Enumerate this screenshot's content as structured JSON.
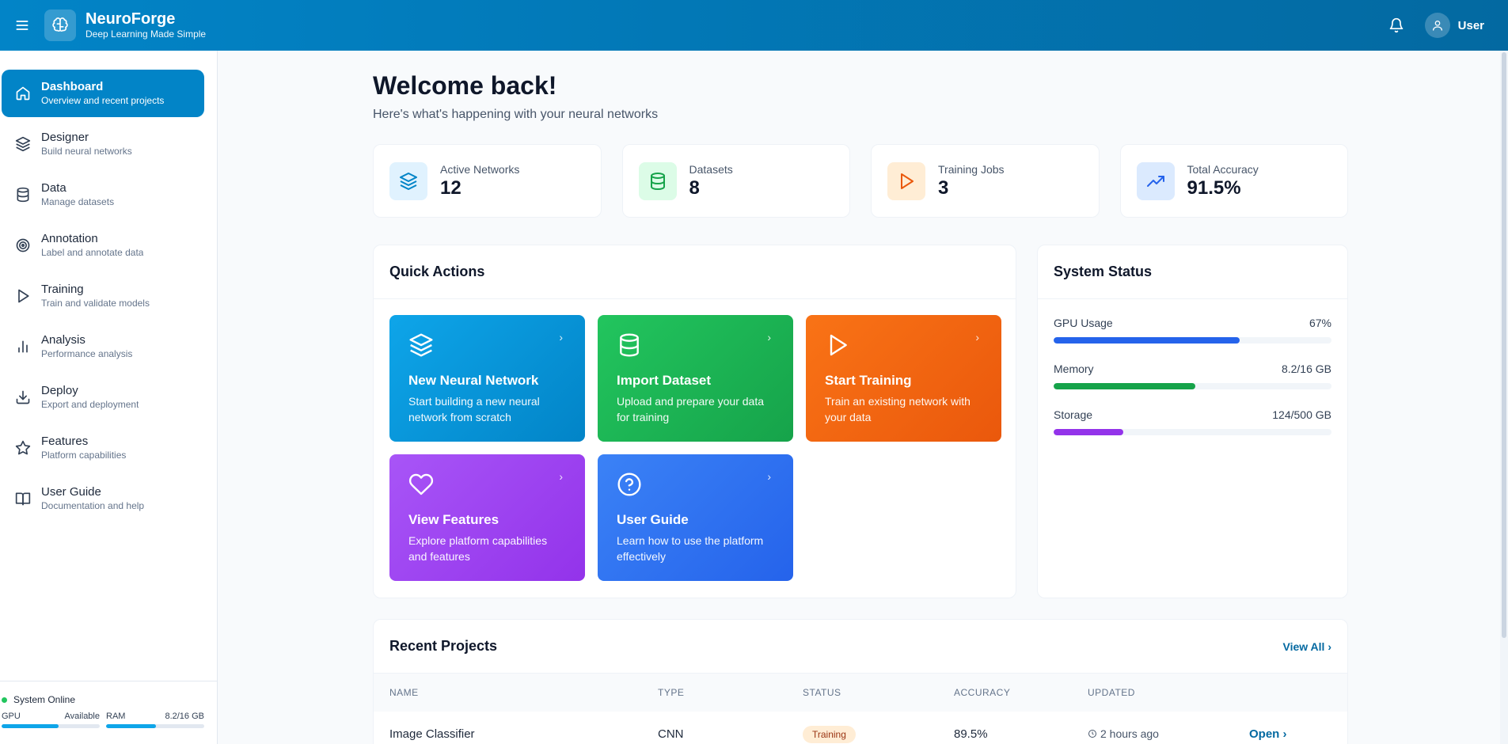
{
  "header": {
    "brand_title": "NeuroForge",
    "brand_subtitle": "Deep Learning Made Simple",
    "user_label": "User"
  },
  "sidebar": {
    "items": [
      {
        "label": "Dashboard",
        "desc": "Overview and recent projects",
        "icon": "home-icon"
      },
      {
        "label": "Designer",
        "desc": "Build neural networks",
        "icon": "layers-icon"
      },
      {
        "label": "Data",
        "desc": "Manage datasets",
        "icon": "database-icon"
      },
      {
        "label": "Annotation",
        "desc": "Label and annotate data",
        "icon": "target-icon"
      },
      {
        "label": "Training",
        "desc": "Train and validate models",
        "icon": "play-icon"
      },
      {
        "label": "Analysis",
        "desc": "Performance analysis",
        "icon": "bar-chart-icon"
      },
      {
        "label": "Deploy",
        "desc": "Export and deployment",
        "icon": "download-icon"
      },
      {
        "label": "Features",
        "desc": "Platform capabilities",
        "icon": "star-icon"
      },
      {
        "label": "User Guide",
        "desc": "Documentation and help",
        "icon": "book-icon"
      }
    ],
    "footer": {
      "status": "System Online",
      "gpu_label": "GPU",
      "gpu_value": "Available",
      "gpu_level": 0.58,
      "ram_label": "RAM",
      "ram_value": "8.2/16 GB",
      "ram_level": 0.51
    }
  },
  "main": {
    "welcome": "Welcome back!",
    "subtitle": "Here's what's happening with your neural networks",
    "stats": [
      {
        "label": "Active Networks",
        "value": "12",
        "icon": "layers-icon",
        "color": "#0284c7",
        "bg": "#e0f2fe"
      },
      {
        "label": "Datasets",
        "value": "8",
        "icon": "database-icon",
        "color": "#16a34a",
        "bg": "#dcfce7"
      },
      {
        "label": "Training Jobs",
        "value": "3",
        "icon": "play-icon",
        "color": "#ea580c",
        "bg": "#ffedd5"
      },
      {
        "label": "Total Accuracy",
        "value": "91.5%",
        "icon": "trending-up-icon",
        "color": "#2563eb",
        "bg": "#dbeafe"
      }
    ],
    "quick_actions": {
      "title": "Quick Actions",
      "items": [
        {
          "title": "New Neural Network",
          "desc": "Start building a new neural network from scratch",
          "icon": "layers-icon"
        },
        {
          "title": "Import Dataset",
          "desc": "Upload and prepare your data for training",
          "icon": "database-icon"
        },
        {
          "title": "Start Training",
          "desc": "Train an existing network with your data",
          "icon": "play-icon"
        },
        {
          "title": "View Features",
          "desc": "Explore platform capabilities and features",
          "icon": "heart-icon"
        },
        {
          "title": "User Guide",
          "desc": "Learn how to use the platform effectively",
          "icon": "help-circle-icon"
        }
      ]
    },
    "system_status": {
      "title": "System Status",
      "rows": [
        {
          "label": "GPU Usage",
          "value": "67%",
          "level": 0.67,
          "color": "#2563eb"
        },
        {
          "label": "Memory",
          "value": "8.2/16 GB",
          "level": 0.51,
          "color": "#16a34a"
        },
        {
          "label": "Storage",
          "value": "124/500 GB",
          "level": 0.25,
          "color": "#9333ea"
        }
      ]
    },
    "recent_projects": {
      "title": "Recent Projects",
      "view_all": "View All",
      "columns": [
        "NAME",
        "TYPE",
        "STATUS",
        "ACCURACY",
        "UPDATED"
      ],
      "rows": [
        {
          "name": "Image Classifier",
          "type": "CNN",
          "status": "Training",
          "accuracy": "89.5%",
          "updated": "2 hours ago",
          "action": "Open"
        }
      ]
    }
  }
}
